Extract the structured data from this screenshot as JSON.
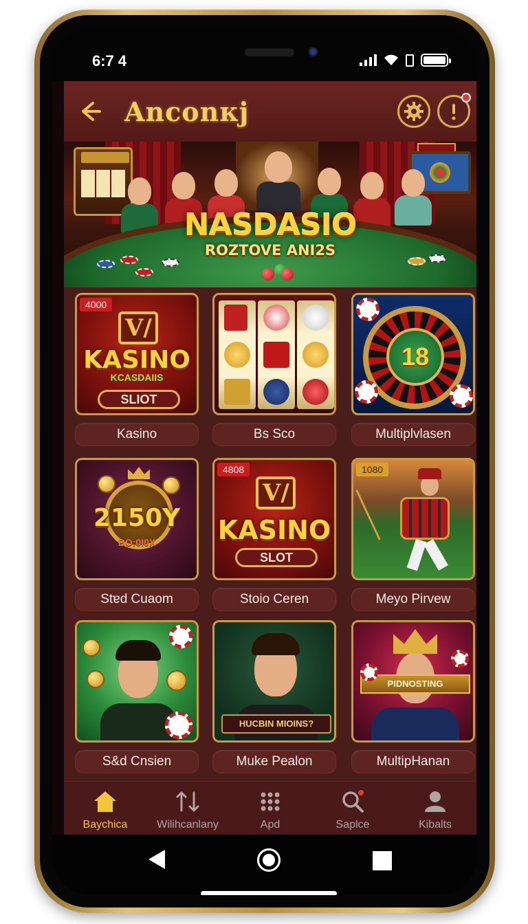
{
  "status_bar": {
    "time": "6:7 4"
  },
  "header": {
    "title": "Anconкj"
  },
  "banner": {
    "title": "NASDASIO",
    "subtitle": "ROZTOVE ANI2S"
  },
  "games": [
    {
      "label": "Kasino",
      "badge": "4000",
      "tile_big": "KASINO",
      "tile_small": "KCASDAIIS",
      "tile_pill": "SLIOT"
    },
    {
      "label": "Bs Sco"
    },
    {
      "label": "Multiplvlasen",
      "tile_big": "18"
    },
    {
      "label": "Stɐd Cuaom",
      "tile_big": "2150Y",
      "tile_small": "BO:0I0X"
    },
    {
      "label": "Stoio Ceren",
      "badge": "4808",
      "tile_big": "KASINO",
      "tile_pill": "SLOT"
    },
    {
      "label": "Meyo Pirvew",
      "badge": "1080"
    },
    {
      "label": "S&d Cnsien"
    },
    {
      "label": "Muke Pealon",
      "ribbon": "HUCBIN MIOINS?"
    },
    {
      "label": "MultipHanan",
      "ribbon": "PIDNOSTING"
    }
  ],
  "bottom_nav": [
    {
      "label": "Baychica",
      "icon": "home-icon",
      "active": true
    },
    {
      "label": "Wilihcanlany",
      "icon": "transfer-icon"
    },
    {
      "label": "Apd",
      "icon": "apps-grid-icon"
    },
    {
      "label": "Saplce",
      "icon": "search-icon"
    },
    {
      "label": "Kibalts",
      "icon": "profile-icon"
    }
  ],
  "colors": {
    "accent_gold": "#f2c53b",
    "background": "#4a1c1a",
    "header": "#6b2522"
  }
}
